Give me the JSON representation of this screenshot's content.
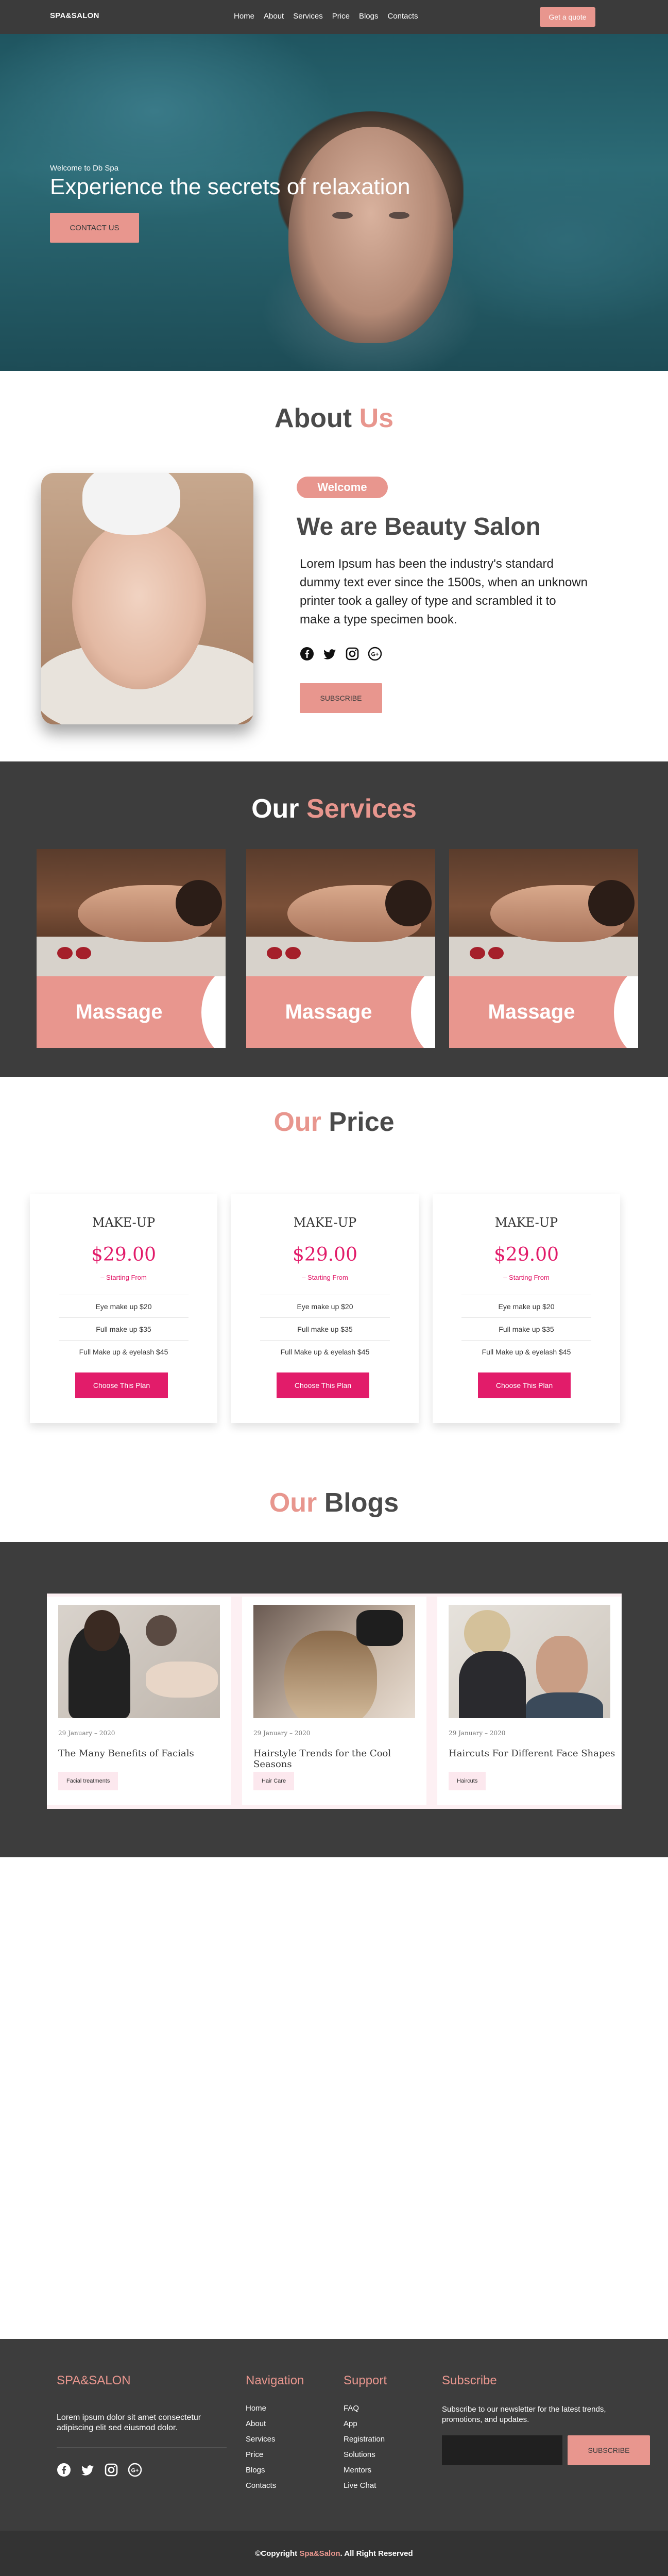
{
  "nav": {
    "brand": "SPA&SALON",
    "items": [
      "Home",
      "About",
      "Services",
      "Price",
      "Blogs",
      "Contacts"
    ],
    "cta": "Get a quote"
  },
  "hero": {
    "eyebrow": "Welcome to Db Spa",
    "title": "Experience the secrets of relaxation",
    "button": "CONTACT US"
  },
  "about": {
    "title_part1": "About ",
    "title_part2": "Us",
    "badge": "Welcome",
    "heading": "We are Beauty Salon",
    "text": "Lorem Ipsum has been the industry's standard dummy text ever since the 1500s, when an unknown printer took a galley of type and scrambled it to make a type specimen book.",
    "social_icons": [
      "facebook-icon",
      "twitter-icon",
      "instagram-icon",
      "google-plus-icon"
    ],
    "button": "SUBSCRIBE"
  },
  "services": {
    "title_part1": "Our ",
    "title_part2": "Services",
    "cards": [
      {
        "label": "Massage"
      },
      {
        "label": "Massage"
      },
      {
        "label": "Massage"
      }
    ]
  },
  "price": {
    "title_part1": "Our ",
    "title_part2": "Price",
    "plans": [
      {
        "name": "MAKE-UP",
        "price": "$29.00",
        "from": "– Starting From",
        "items": [
          "Eye make up $20",
          "Full make up $35",
          "Full Make up & eyelash $45"
        ],
        "button": "Choose This Plan"
      },
      {
        "name": "MAKE-UP",
        "price": "$29.00",
        "from": "– Starting From",
        "items": [
          "Eye make up $20",
          "Full make up $35",
          "Full Make up & eyelash $45"
        ],
        "button": "Choose This Plan"
      },
      {
        "name": "MAKE-UP",
        "price": "$29.00",
        "from": "– Starting From",
        "items": [
          "Eye make up $20",
          "Full make up $35",
          "Full Make up & eyelash $45"
        ],
        "button": "Choose This Plan"
      }
    ]
  },
  "blogs": {
    "title_part1": "Our ",
    "title_part2": "Blogs",
    "posts": [
      {
        "date": "29 January – 2020",
        "title": "The Many Benefits of Facials",
        "tag": "Facial treatments"
      },
      {
        "date": "29 January – 2020",
        "title": "Hairstyle Trends for the Cool Seasons",
        "tag": "Hair Care"
      },
      {
        "date": "29 January – 2020",
        "title": "Haircuts For Different Face Shapes",
        "tag": "Haircuts"
      }
    ]
  },
  "footer": {
    "brand": "SPA&SALON",
    "description": "Lorem ipsum dolor sit amet consectetur adipiscing elit sed eiusmod dolor.",
    "social_icons": [
      "facebook-icon",
      "twitter-icon",
      "instagram-icon",
      "google-plus-icon"
    ],
    "navigation_title": "Navigation",
    "navigation": [
      "Home",
      "About",
      "Services",
      "Price",
      "Blogs",
      "Contacts"
    ],
    "support_title": "Support",
    "support": [
      "FAQ",
      "App",
      "Registration",
      "Solutions",
      "Mentors",
      "Live Chat"
    ],
    "subscribe_title": "Subscribe",
    "subscribe_text": "Subscribe to our newsletter for the latest trends, promotions, and updates.",
    "subscribe_placeholder": "",
    "subscribe_button": "SUBSCRIBE",
    "copyright_part1": "©Copyright ",
    "copyright_part2": "Spa&Salon",
    "copyright_part3": ". All Right Reserved"
  },
  "colors": {
    "accent": "#e8968e",
    "dark": "#3d3d3d",
    "price_accent": "#e21c6a"
  }
}
